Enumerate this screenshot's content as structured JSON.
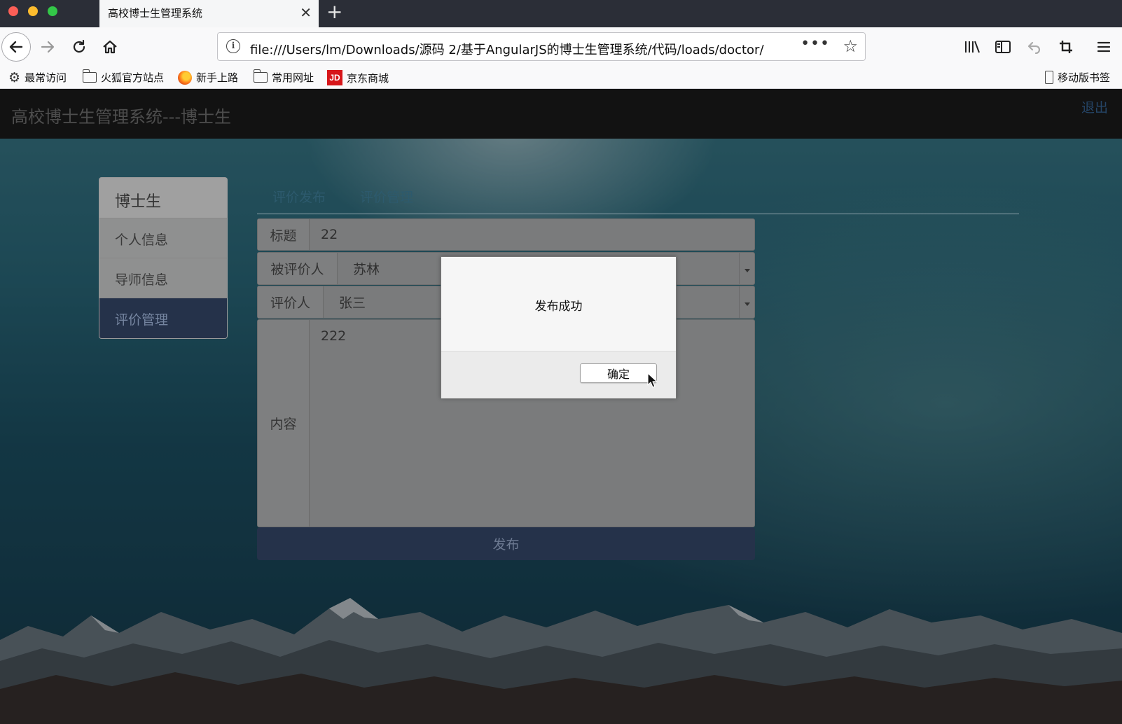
{
  "browser": {
    "tab_title": "高校博士生管理系统",
    "url": "file:///Users/lm/Downloads/源码 2/基于AngularJS的博士生管理系统/代码/loads/doctor/",
    "bookmarks": [
      "最常访问",
      "火狐官方站点",
      "新手上路",
      "常用网址",
      "京东商城"
    ],
    "mobile_bookmarks": "移动版书签",
    "jd_logo_text": "JD"
  },
  "header": {
    "brand": "高校博士生管理系统---博士生",
    "logout": "退出"
  },
  "sidebar": {
    "heading": "博士生",
    "items": [
      {
        "label": "个人信息",
        "active": false
      },
      {
        "label": "导师信息",
        "active": false
      },
      {
        "label": "评价管理",
        "active": true
      }
    ]
  },
  "tabs": [
    "评价发布",
    "评价管理"
  ],
  "form": {
    "title_label": "标题",
    "title_value": "22",
    "evaluatee_label": "被评价人",
    "evaluatee_value": "苏林",
    "evaluator_label": "评价人",
    "evaluator_value": "张三",
    "content_label": "内容",
    "content_value": "222",
    "submit_label": "发布"
  },
  "dialog": {
    "message": "发布成功",
    "ok_label": "确定"
  }
}
